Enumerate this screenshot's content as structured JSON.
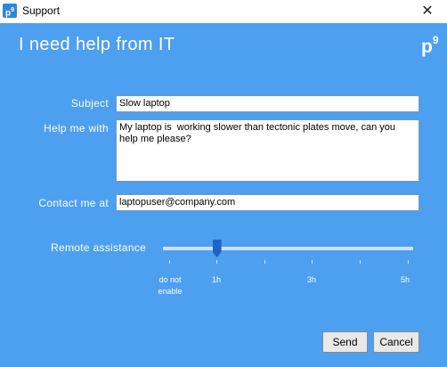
{
  "window": {
    "app_icon": "p9",
    "title": "Support",
    "close_glyph": "✕"
  },
  "header": {
    "heading": "I need help from IT",
    "logo": "p9"
  },
  "form": {
    "subject_label": "Subject",
    "subject_value": "Slow laptop",
    "help_label": "Help me with",
    "help_value": "My laptop is  working slower than tectonic plates move, can you help me please?",
    "contact_label": "Contact me at",
    "contact_value": "laptopuser@company.com"
  },
  "remote": {
    "label": "Remote assistance",
    "options": [
      "do not enable",
      "1h",
      "3h",
      "5h"
    ],
    "selected": "1h",
    "level": 0.2
  },
  "buttons": {
    "send": "Send",
    "cancel": "Cancel"
  },
  "colors": {
    "panel": "#4d9ff0",
    "thumb": "#1e63c8"
  }
}
